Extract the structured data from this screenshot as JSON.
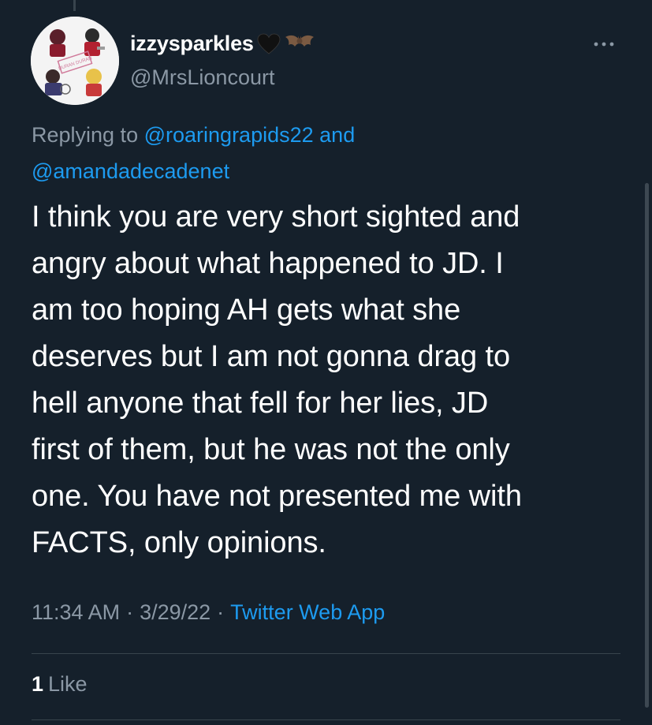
{
  "tweet": {
    "author": {
      "display_name": "izzysparkles",
      "name_emojis": [
        "black-heart-icon",
        "bat-icon"
      ],
      "handle": "@MrsLioncourt",
      "avatar_badge_text": "DURAN DURAN"
    },
    "replying_to": {
      "prefix": "Replying to",
      "user1": "@roaringrapids22",
      "conjunction": "and",
      "user2": "@amandadecadenet"
    },
    "text_lines": [
      "I think you are very short sighted and",
      "angry about what happened to JD. I",
      "am too hoping AH gets what she",
      "deserves but I am not gonna drag to",
      "hell anyone that fell for her lies, JD",
      "first of them, but he was not the only",
      "one. You have not presented me with",
      "FACTS, only opinions."
    ],
    "time": "11:34 AM",
    "separator": "·",
    "date": "3/29/22",
    "source": "Twitter Web App",
    "likes": {
      "count": "1",
      "label": "Like"
    }
  },
  "colors": {
    "background": "#15202b",
    "text": "#ffffff",
    "secondary_text": "#8b98a5",
    "link": "#1d9bf0",
    "divider": "#38444d"
  }
}
